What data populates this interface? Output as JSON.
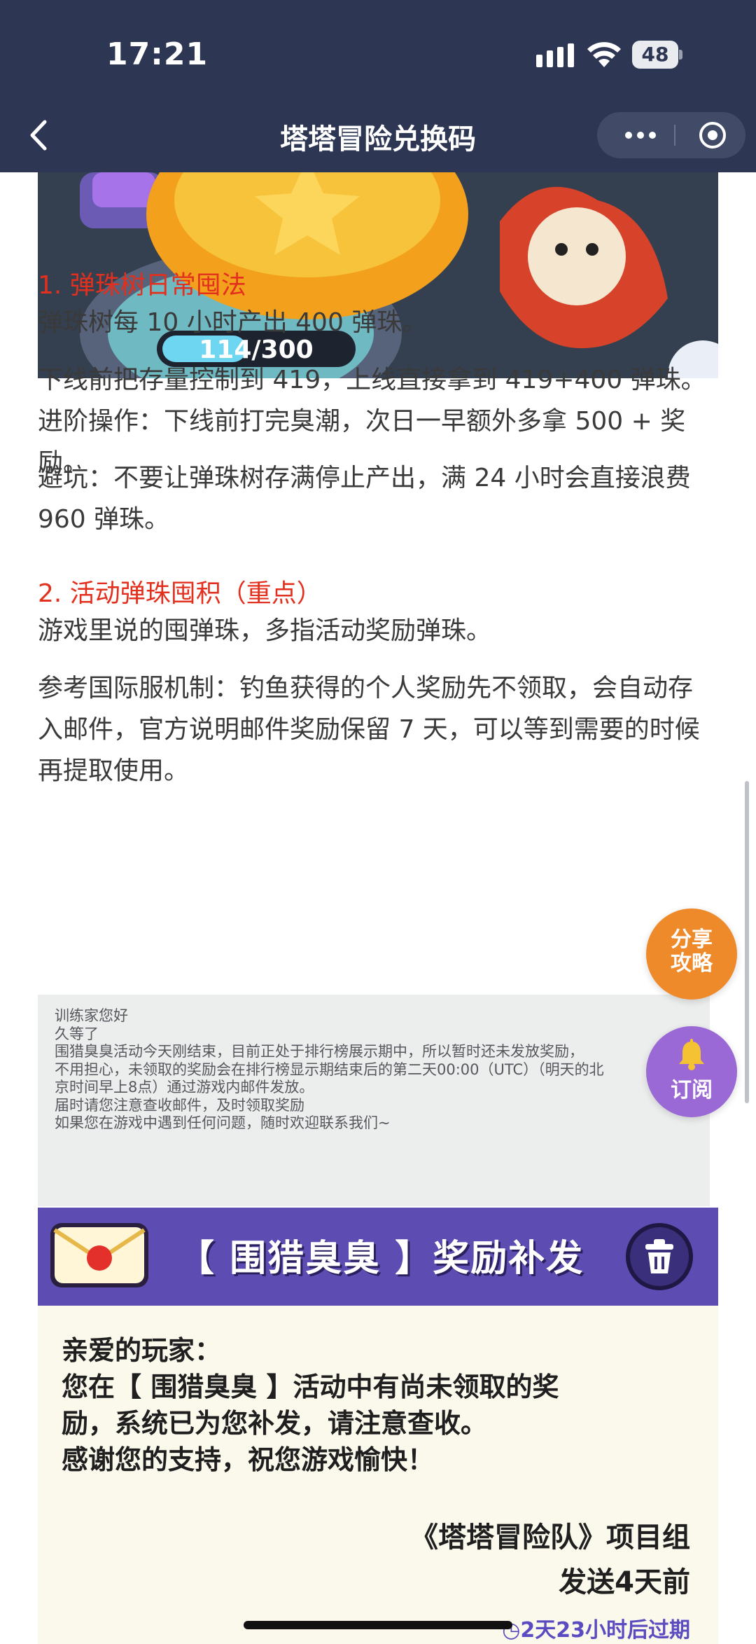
{
  "status_bar": {
    "time": "17:21",
    "battery": "48"
  },
  "nav": {
    "title": "塔塔冒险兑换码",
    "back_icon": "chevron-left-icon",
    "more_icon": "more-dots-icon",
    "close_icon": "target-close-icon"
  },
  "article": {
    "game_image": {
      "progress_text": "114/300"
    },
    "section1": {
      "heading": "1. 弹珠树日常囤法",
      "para1": "弹珠树每 10 小时产出 400 弹珠。",
      "para2": "下线前把存量控制到 419，上线直接拿到 419+400 弹珠。进阶操作：下线前打完臭潮，次日一早额外多拿 500 + 奖励。",
      "para3": "避坑：不要让弹珠树存满停止产出，满 24 小时会直接浪费 960 弹珠。"
    },
    "section2": {
      "heading": "2. 活动弹珠囤积（重点）",
      "para1": "游戏里说的囤弹珠，多指活动奖励弹珠。",
      "para2": "参考国际服机制：钓鱼获得的个人奖励先不领取，会自动存入邮件，官方说明邮件奖励保留 7 天，可以等到需要的时候再提取使用。"
    },
    "notice_image": {
      "lines": [
        "训练家您好",
        "久等了",
        "围猎臭臭活动今天刚结束，目前正处于排行榜展示期中，所以暂时还未发放奖励，",
        "不用担心，未领取的奖励会在排行榜显示期结束后的第二天00:00（UTC）（明天的北",
        "京时间早上8点）通过游戏内邮件发放。",
        "届时请您注意查收邮件，及时领取奖励",
        "如果您在游戏中遇到任何问题，随时欢迎联系我们~"
      ]
    },
    "mail_image": {
      "title": "【 围猎臭臭 】奖励补发",
      "body": [
        "亲爱的玩家：",
        "您在【 围猎臭臭 】活动中有尚未领取的奖",
        "励，系统已为您补发，请注意查收。",
        "感谢您的支持，祝您游戏愉快！"
      ],
      "signature": "《塔塔冒险队》项目组",
      "sent": "发送4天前",
      "expire": "2天23小时后过期"
    }
  },
  "fab": {
    "share_line1": "分享",
    "share_line2": "攻略",
    "subscribe": "订阅",
    "bell_icon": "bell-icon"
  },
  "colors": {
    "nav_bg": "#2d3653",
    "heading_red": "#e3301e",
    "share_orange": "#ef8a2b",
    "subscribe_purple": "#9b69d6",
    "mail_purple": "#5d4db2"
  }
}
